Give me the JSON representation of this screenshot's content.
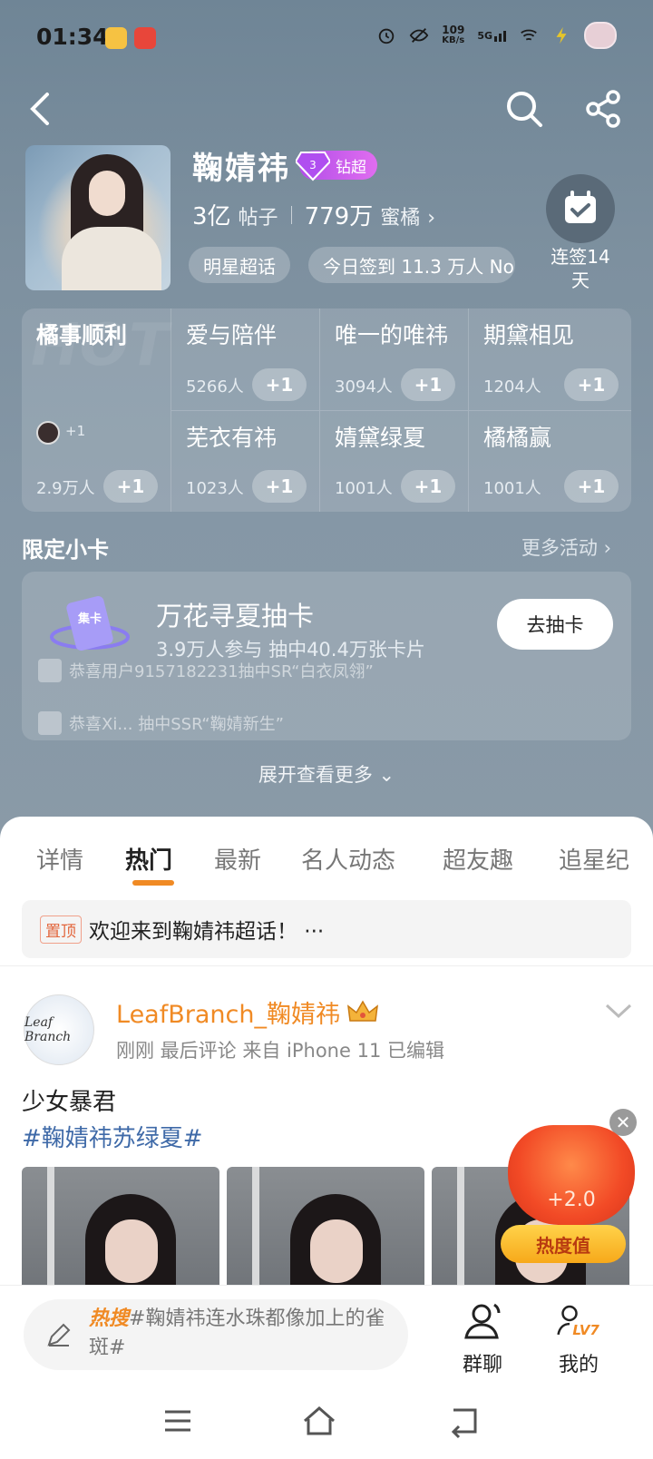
{
  "status_bar": {
    "time": "01:34",
    "net_speed": "109",
    "net_unit": "KB/s",
    "network": "5G"
  },
  "profile": {
    "title": "鞠婧祎",
    "badge": "钻超",
    "posts_count": "3亿",
    "posts_label": "帖子",
    "fans_count": "779万",
    "fans_label": "蜜橘",
    "chip_type": "明星超话",
    "chip_checkin": "今日签到 11.3 万人 No.",
    "checkin_label": "连签14天"
  },
  "grid": {
    "watermark": "HOT",
    "featured": {
      "title": "橘事顺利",
      "mini_plus": "+1",
      "count": "2.9万人",
      "plus": "+1"
    },
    "cells": [
      {
        "title": "爱与陪伴",
        "count": "5266人",
        "plus": "+1"
      },
      {
        "title": "唯一的唯祎",
        "count": "3094人",
        "plus": "+1"
      },
      {
        "title": "期黛相见",
        "count": "1204人",
        "plus": "+1"
      },
      {
        "title": "芜衣有祎",
        "count": "1023人",
        "plus": "+1"
      },
      {
        "title": "婧黛绿夏",
        "count": "1001人",
        "plus": "+1"
      },
      {
        "title": "橘橘赢",
        "count": "1001人",
        "plus": "+1"
      }
    ]
  },
  "limited": {
    "section_title": "限定小卡",
    "more": "更多活动",
    "card_icon_text": "集卡",
    "card_title": "万花寻夏抽卡",
    "card_sub": "3.9万人参与 抽中40.4万张卡片",
    "card_button": "去抽卡",
    "ticker": [
      "恭喜用户9157182231抽中SR“白衣凤翎”",
      "恭喜Xi... 抽中SSR“鞠婧新生”"
    ],
    "expand": "展开查看更多"
  },
  "tabs": [
    "详情",
    "热门",
    "最新",
    "名人动态",
    "超友趣",
    "追星纪"
  ],
  "active_tab": "热门",
  "pinned": {
    "tag": "置顶",
    "text": "欢迎来到鞠婧祎超话！ ···"
  },
  "post": {
    "avatar_text": "Leaf Branch",
    "user": "LeafBranch_鞠婧祎",
    "meta": "刚刚  最后评论   来自 iPhone 11   已编辑",
    "text": "少女暴君",
    "tag": "#鞠婧祎苏绿夏#"
  },
  "floating": {
    "value": "+2.0",
    "button": "热度值"
  },
  "bottom": {
    "hot_label": "热搜",
    "compose_text": "#鞠婧祎连水珠都像加上的雀斑#",
    "group_chat": "群聊",
    "mine": "我的",
    "level": "LV7"
  },
  "colors": {
    "accent": "#f08a24",
    "link": "#3f6aa8",
    "header_bg": "#7d909f"
  }
}
